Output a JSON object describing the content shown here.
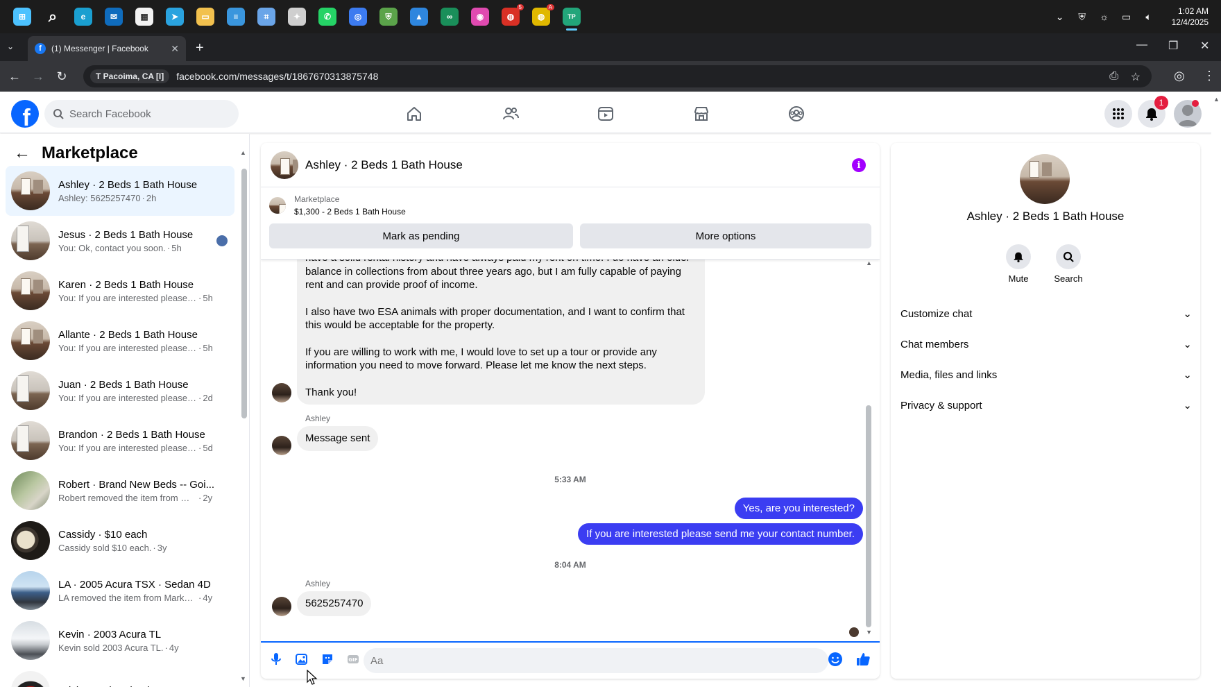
{
  "taskbar": {
    "apps": [
      {
        "name": "start",
        "color": "#4cc2ff",
        "glyph": "⊞"
      },
      {
        "name": "search",
        "color": "transparent",
        "glyph": "⌕"
      },
      {
        "name": "edge",
        "color": "#1a9fd0",
        "glyph": "e"
      },
      {
        "name": "outlook",
        "color": "#0f6cbd",
        "glyph": "✉"
      },
      {
        "name": "store",
        "color": "#f2f2f2",
        "glyph": "▦"
      },
      {
        "name": "telegram",
        "color": "#2aa3df",
        "glyph": "➤"
      },
      {
        "name": "files",
        "color": "#f2c14e",
        "glyph": "▭"
      },
      {
        "name": "notepad",
        "color": "#3a96dd",
        "glyph": "≡"
      },
      {
        "name": "snip",
        "color": "#6aa5e8",
        "glyph": "⌗"
      },
      {
        "name": "tool",
        "color": "#cfcfcf",
        "glyph": "✦"
      },
      {
        "name": "whatsapp",
        "color": "#25d366",
        "glyph": "✆"
      },
      {
        "name": "chrome-remote",
        "color": "#3c7bf0",
        "glyph": "◎"
      },
      {
        "name": "vpn",
        "color": "#5ba34a",
        "glyph": "⛨"
      },
      {
        "name": "drive",
        "color": "#2e86de",
        "glyph": "▲"
      },
      {
        "name": "tripadvisor",
        "color": "#1a8f5a",
        "glyph": "∞"
      },
      {
        "name": "color",
        "color": "#e04ab0",
        "glyph": "◉"
      },
      {
        "name": "chrome-1",
        "color": "#d93025",
        "glyph": "◍",
        "badge": "5"
      },
      {
        "name": "chrome-2",
        "color": "#e0b800",
        "glyph": "◍",
        "badge": "A"
      },
      {
        "name": "tp-app",
        "color": "#22a57a",
        "glyph": "TP"
      }
    ],
    "clock_time": "1:02 AM",
    "clock_date": "12/4/2025"
  },
  "browser": {
    "tab_title": "(1) Messenger | Facebook",
    "location_chip": "T Pacoima, CA [I]",
    "url": "facebook.com/messages/t/1867670313875748"
  },
  "fb": {
    "search_placeholder": "Search Facebook",
    "notification_count": "1"
  },
  "sidebar": {
    "title": "Marketplace",
    "conversations": [
      {
        "name": "Ashley · 2 Beds 1 Bath House",
        "preview": "Ashley: 5625257470",
        "time": "2h",
        "thumb": "room",
        "selected": true
      },
      {
        "name": "Jesus · 2 Beds 1 Bath House",
        "preview": "You: Ok, contact you soon.",
        "time": "5h",
        "thumb": "room2",
        "seen": true
      },
      {
        "name": "Karen · 2 Beds 1 Bath House",
        "preview": "You: If you are interested please se...",
        "time": "5h",
        "thumb": "room"
      },
      {
        "name": "Allante · 2 Beds 1 Bath House",
        "preview": "You: If you are interested please se...",
        "time": "5h",
        "thumb": "room"
      },
      {
        "name": "Juan · 2 Beds 1 Bath House",
        "preview": "You: If you are interested please se...",
        "time": "2d",
        "thumb": "room2"
      },
      {
        "name": "Brandon · 2 Beds 1 Bath House",
        "preview": "You: If you are interested please se...",
        "time": "5d",
        "thumb": "room2"
      },
      {
        "name": "Robert · Brand New Beds -- Goi...",
        "preview": "Robert removed the item from Mar...",
        "time": "2y",
        "thumb": "trees"
      },
      {
        "name": "Cassidy · $10 each",
        "preview": "Cassidy sold $10 each.",
        "time": "3y",
        "thumb": "cups"
      },
      {
        "name": "LA · 2005 Acura TSX · Sedan 4D",
        "preview": "LA removed the item from Marketp...",
        "time": "4y",
        "thumb": "car1"
      },
      {
        "name": "Kevin · 2003 Acura TL",
        "preview": "Kevin sold 2003 Acura TL.",
        "time": "4y",
        "thumb": "car2"
      },
      {
        "name": "Erick · Trade Wheel",
        "preview": "",
        "time": "",
        "thumb": "wheel"
      }
    ]
  },
  "chat": {
    "title": "Ashley · 2 Beds 1 Bath House",
    "listing_category": "Marketplace",
    "listing_price": "$1,300 - 2 Beds 1 Bath House",
    "mark_pending": "Mark as pending",
    "more_options": "More options",
    "long_message": {
      "p1": "have a solid rental history and have always paid my rent on time. I do have an older balance in collections from about three years ago, but I am fully capable of paying rent and can provide proof of income.",
      "p2": "I also have two ESA animals with proper documentation, and I want to confirm that this would be acceptable for the property.",
      "p3": "If you are willing to work with me, I would love to set up a tour or provide any information you need to move forward. Please let me know the next steps.",
      "p4": "Thank you!"
    },
    "sender_name": "Ashley",
    "msg_sent": "Message sent",
    "ts1": "5:33 AM",
    "out1": "Yes, are you interested?",
    "out2": "If you are interested please send me your contact number.",
    "ts2": "8:04 AM",
    "phone_msg": "5625257470",
    "input_placeholder": "Aa"
  },
  "info": {
    "name": "Ashley · 2 Beds 1 Bath House",
    "mute": "Mute",
    "search": "Search",
    "rows": [
      "Customize chat",
      "Chat members",
      "Media, files and links",
      "Privacy & support"
    ]
  },
  "colors": {
    "fb_blue": "#0866ff",
    "outgoing_bubble": "#3b3df2",
    "info_purple": "#a200ff",
    "selected_row": "#ebf5ff"
  }
}
